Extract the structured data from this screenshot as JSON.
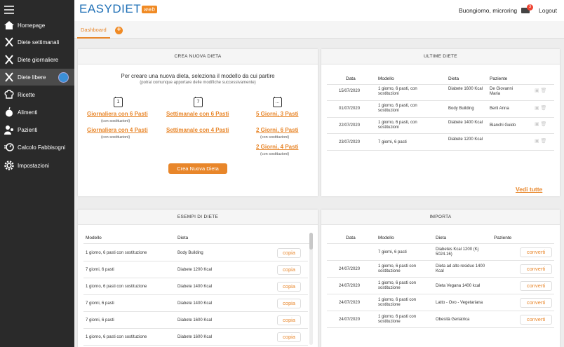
{
  "sidebar": {
    "items": [
      {
        "label": "Homepage",
        "icon": "home-icon"
      },
      {
        "label": "Diete settimanali",
        "icon": "cutlery-icon"
      },
      {
        "label": "Diete giornaliere",
        "icon": "cutlery-icon"
      },
      {
        "label": "Diete libere",
        "icon": "cutlery-icon"
      },
      {
        "label": "Ricette",
        "icon": "chef-hat-icon"
      },
      {
        "label": "Alimenti",
        "icon": "apple-icon"
      },
      {
        "label": "Pazienti",
        "icon": "users-icon"
      },
      {
        "label": "Calcolo Fabbisogni",
        "icon": "scale-icon"
      },
      {
        "label": "Impostazioni",
        "icon": "gear-icon"
      }
    ]
  },
  "header": {
    "logo": "EASYDIET",
    "logo_web": "web",
    "greeting": "Buongiorno, microring",
    "mail_count": "3",
    "logout": "Logout"
  },
  "tabs": {
    "dashboard": "Dashboard"
  },
  "crea": {
    "title": "CREA NUOVA DIETA",
    "intro": "Per creare una nuova dieta, seleziona il modello da cui partire",
    "intro_sub": "(potrai comunque apportare delle modifiche successivamente)",
    "col1": {
      "icon_text": "1",
      "l1": "Giornaliera con 6 Pasti",
      "s1": "(con sostituzioni)",
      "l2": "Giornaliera con 4 Pasti",
      "s2": "(con sostituzioni)"
    },
    "col2": {
      "icon_text": "7",
      "l1": "Settimanale con 6 Pasti",
      "l2": "Settimanale con 4 Pasti"
    },
    "col3": {
      "icon_text": "...",
      "l1": "5 Giorni, 3 Pasti",
      "l2": "2 Giorni, 6 Pasti",
      "s2": "(con sostituzioni)",
      "l3": "2 Giorni, 4 Pasti",
      "s3": "(con sostituzioni)"
    },
    "button": "Crea Nuova Dieta"
  },
  "ultime": {
    "title": "ULTIME DIETE",
    "headers": {
      "data": "Data",
      "modello": "Modello",
      "dieta": "Dieta",
      "paziente": "Paziente"
    },
    "rows": [
      {
        "data": "15/07/2020",
        "modello": "1 giorno, 6 pasti, con sostituzioni",
        "dieta": "Diabete 1600 Kcal",
        "paziente": "De Giovanni Maria"
      },
      {
        "data": "01/07/2020",
        "modello": "1 giorno, 6 pasti, con sostituzioni",
        "dieta": "Body Building",
        "paziente": "Berti Anna"
      },
      {
        "data": "22/07/2020",
        "modello": "1 giorno, 6 pasti, con sostituzioni",
        "dieta": "Diabete 1400 Kcal",
        "paziente": "Bianchi Guido"
      },
      {
        "data": "23/07/2020",
        "modello": "7 giorni, 6 pasti",
        "dieta": "Diabete 1200 Kcal",
        "paziente": ""
      }
    ],
    "vedi": "Vedi tutte"
  },
  "esempi": {
    "title": "ESEMPI DI DIETE",
    "headers": {
      "modello": "Modello",
      "dieta": "Dieta"
    },
    "button": "copia",
    "rows": [
      {
        "modello": "1 giorno, 6 pasti con sostituzione",
        "dieta": "Body Building"
      },
      {
        "modello": "7 giorni, 6 pasti",
        "dieta": "Diabete 1200 Kcal"
      },
      {
        "modello": "1 giorno, 6 pasti con sostituzione",
        "dieta": "Diabete 1400 Kcal"
      },
      {
        "modello": "7 giorni, 6 pasti",
        "dieta": "Diabete 1400 Kcal"
      },
      {
        "modello": "7 giorni, 6 pasti",
        "dieta": "Diabete 1600 Kcal"
      },
      {
        "modello": "1 giorno, 6 pasti con sostituzione",
        "dieta": "Diabete 1600 Kcal"
      }
    ]
  },
  "importa": {
    "title": "IMPORTA",
    "headers": {
      "data": "Data",
      "modello": "Modello",
      "dieta": "Dieta",
      "paziente": "Paziente"
    },
    "button": "converti",
    "rows": [
      {
        "data": "",
        "modello": "7 giorni, 6 pasti",
        "dieta": "Diabetes Kcal 1200 (Kj 5024.16)"
      },
      {
        "data": "24/07/2020",
        "modello": "1 giorno, 6 pasti con sostituzione",
        "dieta": "Dieta ad alto residuo 1400 Kcal"
      },
      {
        "data": "24/07/2020",
        "modello": "1 giorno, 6 pasti con sostituzione",
        "dieta": "Dieta Vegana 1400 kcal"
      },
      {
        "data": "24/07/2020",
        "modello": "1 giorno, 6 pasti con sostituzione",
        "dieta": "Latto - Ovo - Vegetariana"
      },
      {
        "data": "24/07/2020",
        "modello": "1 giorno, 6 pasti con sostituzione",
        "dieta": "Obesità Geriatrica"
      }
    ]
  },
  "colors": {
    "accent": "#e8862a",
    "sidebar": "#2a2a2a",
    "logo": "#1e6fb6"
  }
}
